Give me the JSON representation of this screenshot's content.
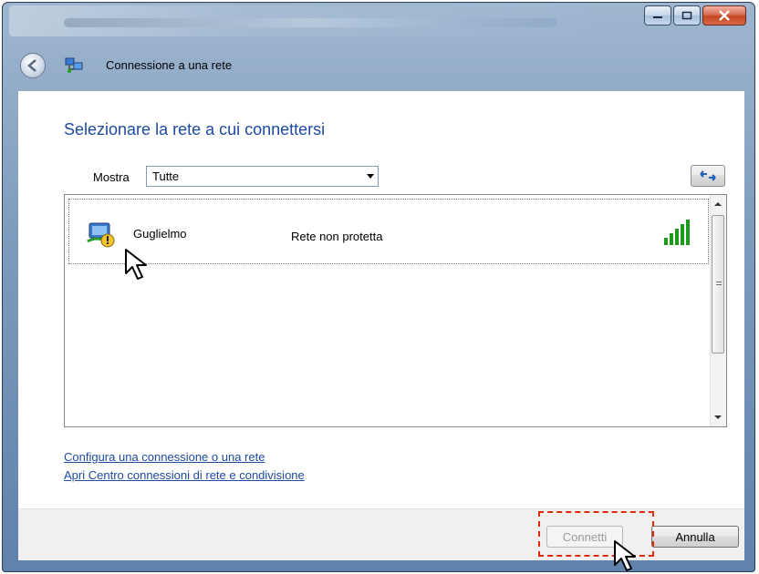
{
  "window": {
    "title": "Connessione a una rete",
    "caption_buttons": [
      "minimize-icon",
      "maximize-icon",
      "close-icon"
    ]
  },
  "main": {
    "heading": "Selezionare la rete a cui connettersi",
    "show_label": "Mostra",
    "show_selected": "Tutte",
    "refresh_icon": "refresh-icon"
  },
  "networks": [
    {
      "name": "Guglielmo",
      "security": "Rete non protetta",
      "signal_icon": "signal-strength-icon"
    }
  ],
  "links": {
    "setup": "Configura una connessione o una rete",
    "network_center": "Apri Centro connessioni di rete e condivisione"
  },
  "buttons": {
    "connect": "Connetti",
    "cancel": "Annulla"
  },
  "colors": {
    "heading": "#1e4aa0",
    "link": "#1e4aa0",
    "highlight": "#e02a0a",
    "signal": "#1c9a1c"
  }
}
